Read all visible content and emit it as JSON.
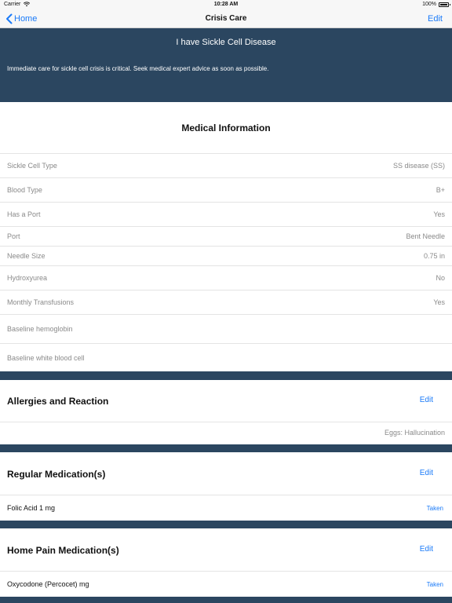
{
  "status_bar": {
    "carrier": "Carrier",
    "time": "10:28 AM",
    "battery": "100%"
  },
  "nav": {
    "back_label": "Home",
    "title": "Crisis Care",
    "edit_label": "Edit"
  },
  "banner": {
    "title": "I have Sickle Cell Disease",
    "text": "Immediate care for sickle cell crisis is critical. Seek medical expert advice as soon as possible."
  },
  "medical_info": {
    "title": "Medical Information",
    "rows": [
      {
        "label": "Sickle Cell Type",
        "value": "SS disease (SS)"
      },
      {
        "label": "Blood Type",
        "value": "B+"
      },
      {
        "label": "Has a Port",
        "value": "Yes"
      },
      {
        "label": "Port",
        "value": "Bent Needle"
      },
      {
        "label": "Needle Size",
        "value": "0.75 in"
      },
      {
        "label": "Hydroxyurea",
        "value": "No"
      },
      {
        "label": "Monthly Transfusions",
        "value": "Yes"
      },
      {
        "label": "Baseline hemoglobin",
        "value": ""
      },
      {
        "label": "Baseline white blood cell",
        "value": ""
      }
    ]
  },
  "allergies": {
    "title": "Allergies and Reaction",
    "edit_label": "Edit",
    "items": [
      "Eggs: Hallucination"
    ]
  },
  "regular_meds": {
    "title": "Regular Medication(s)",
    "edit_label": "Edit",
    "items": [
      {
        "name": "Folic Acid 1 mg",
        "status": "Taken"
      }
    ]
  },
  "home_pain_meds": {
    "title": "Home Pain Medication(s)",
    "edit_label": "Edit",
    "items": [
      {
        "name": "Oxycodone (Percocet) mg",
        "status": "Taken"
      }
    ]
  },
  "colors": {
    "accent": "#1a7af8",
    "banner_bg": "#2b4660",
    "secondary_text": "#8a8a8a"
  }
}
